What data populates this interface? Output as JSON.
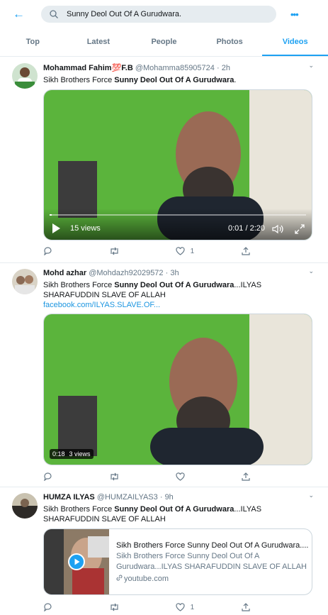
{
  "header": {
    "search_query": "Sunny Deol Out Of A Gurudwara."
  },
  "tabs": [
    {
      "label": "Top",
      "active": false
    },
    {
      "label": "Latest",
      "active": false
    },
    {
      "label": "People",
      "active": false
    },
    {
      "label": "Photos",
      "active": false
    },
    {
      "label": "Videos",
      "active": true
    }
  ],
  "tweets": [
    {
      "name": "Mohammad Fahim💯F.B",
      "handle": "@Mohamma85905724",
      "dot": "·",
      "time": "2h",
      "text_prefix": "Sikh Brothers Force ",
      "text_bold": "Sunny Deol Out Of A Gurudwara",
      "text_suffix": ".",
      "video": {
        "views": "15 views",
        "timecode": "0:01 / 2:20",
        "progress": 0.007
      },
      "likes": "1"
    },
    {
      "name": "Mohd azhar",
      "handle": "@Mohdazh92029572",
      "dot": "·",
      "time": "3h",
      "text_prefix": "Sikh Brothers Force ",
      "text_bold": "Sunny Deol Out Of A Gurudwara",
      "text_suffix": "...ILYAS SHARAFUDDIN SLAVE OF ALLAH",
      "link": "facebook.com/ILYAS.SLAVE.OF...",
      "video": {
        "duration": "0:18",
        "views": "3 views"
      },
      "likes": ""
    },
    {
      "name": "HUMZA ILYAS",
      "handle": "@HUMZAILYAS3",
      "dot": "·",
      "time": "9h",
      "text_prefix": "Sikh Brothers Force ",
      "text_bold": "Sunny Deol Out Of A Gurudwara",
      "text_suffix": "...ILYAS SHARAFUDDIN SLAVE OF ALLAH",
      "card": {
        "title": "Sikh Brothers Force Sunny Deol Out Of A Gurudwara....",
        "description": "Sikh Brothers Force Sunny Deol Out Of A Gurudwara...ILYAS SHARAFUDDIN SLAVE OF ALLAH",
        "domain": "youtube.com"
      },
      "likes": "1"
    }
  ],
  "icons": [
    "back-arrow-icon",
    "search-icon",
    "more-icon",
    "caret-down-icon",
    "reply-icon",
    "retweet-icon",
    "like-icon",
    "share-icon",
    "play-icon",
    "volume-icon",
    "fullscreen-icon",
    "link-icon"
  ],
  "colors": {
    "accent": "#1da1f2",
    "secondary_text": "#657786",
    "border": "#e6ecf0"
  }
}
